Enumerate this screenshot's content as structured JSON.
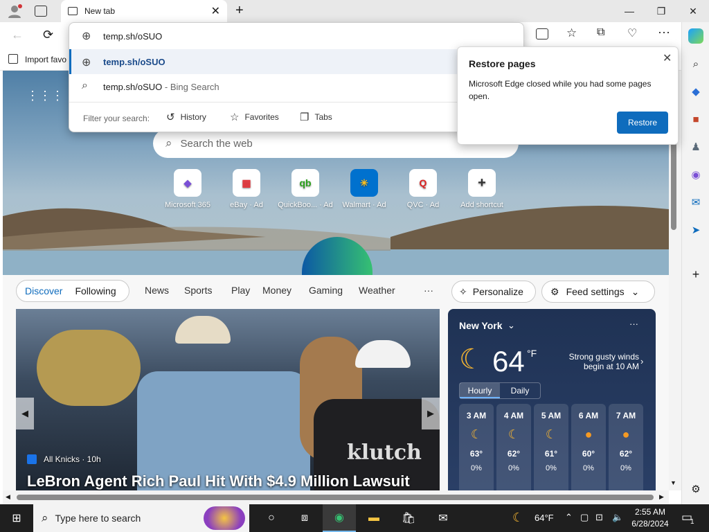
{
  "tab": {
    "title": "New tab"
  },
  "omnibox": {
    "value": "temp.sh/oSUO",
    "suggestion1": "temp.sh/oSUO",
    "suggestion2": "temp.sh/oSUO",
    "suggestion2_suffix": " - Bing Search",
    "filter_label": "Filter your search:",
    "filter_history": "History",
    "filter_favorites": "Favorites",
    "filter_tabs": "Tabs"
  },
  "favbar": {
    "import": "Import favo"
  },
  "restore": {
    "title": "Restore pages",
    "body": "Microsoft Edge closed while you had some pages open.",
    "button": "Restore"
  },
  "newtab": {
    "search_placeholder": "Search the web",
    "tiles": [
      "Microsoft 365",
      "eBay · Ad",
      "QuickBoo... · Ad",
      "Walmart · Ad",
      "QVC · Ad",
      "Add shortcut"
    ]
  },
  "feed": {
    "discover": "Discover",
    "following": "Following",
    "nav": [
      "News",
      "Sports",
      "Play",
      "Money",
      "Gaming",
      "Weather"
    ],
    "more": "···",
    "personalize": "Personalize",
    "feed_settings": "Feed settings",
    "news_source": "All Knicks · 10h",
    "news_headline": "LeBron Agent Rich Paul Hit With $4.9 Million Lawsuit",
    "jersey_text": "klutch"
  },
  "weather": {
    "city": "New York",
    "temp": "64",
    "unit": "°F",
    "alert": "Strong gusty winds begin at 10 AM",
    "hourly": "Hourly",
    "daily": "Daily",
    "hours": [
      {
        "time": "3 AM",
        "temp": "63°",
        "precip": "0%"
      },
      {
        "time": "4 AM",
        "temp": "62°",
        "precip": "0%"
      },
      {
        "time": "5 AM",
        "temp": "61°",
        "precip": "0%"
      },
      {
        "time": "6 AM",
        "temp": "60°",
        "precip": "0%"
      },
      {
        "time": "7 AM",
        "temp": "62°",
        "precip": "0%"
      }
    ]
  },
  "taskbar": {
    "search": "Type here to search",
    "weather_temp": "64°F",
    "time": "2:55 AM",
    "date": "6/28/2024",
    "notif_count": "1"
  },
  "colors": {
    "accent": "#0f6cbd",
    "taskbar": "#1f1f1f"
  }
}
